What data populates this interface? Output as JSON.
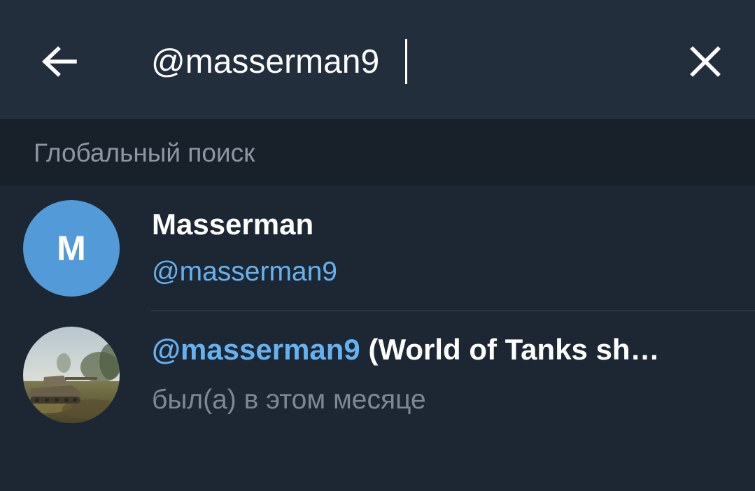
{
  "search": {
    "query": "@masserman9",
    "back_icon": "arrow-left-icon",
    "clear_icon": "close-icon"
  },
  "section": {
    "title": "Глобальный поиск"
  },
  "results": [
    {
      "avatar_letter": "M",
      "avatar_color": "#539ad9",
      "name": "Masserman",
      "subtitle": "@masserman9"
    },
    {
      "avatar_image": "tank-photo",
      "handle": "@masserman9",
      "name_rest": " (World of Tanks sh…",
      "subtitle": "был(а) в этом месяце"
    }
  ],
  "colors": {
    "topbar": "#232e3c",
    "background": "#1d2733",
    "section_header": "#18202a",
    "accent": "#66b1f0",
    "muted": "#7e8893"
  }
}
